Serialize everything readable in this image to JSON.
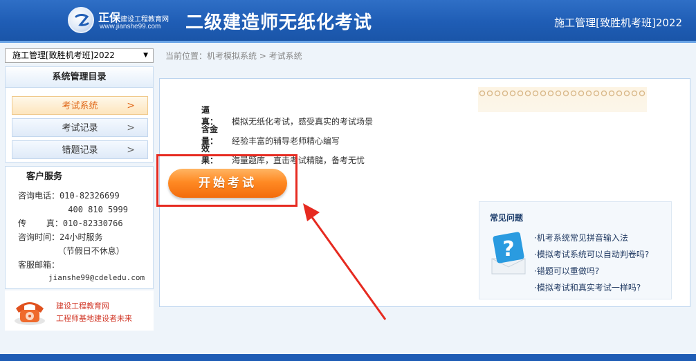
{
  "header": {
    "logo_name": "正保",
    "logo_sub": "建设工程教育网",
    "logo_url": "www.jianshe99.com",
    "app_title": "二级建造师无纸化考试",
    "course_title": "施工管理[致胜机考班]2022"
  },
  "sidebar": {
    "course_select": "施工管理[致胜机考班]2022",
    "menu_title": "系统管理目录",
    "items": [
      {
        "label": "考试系统",
        "active": true
      },
      {
        "label": "考试记录",
        "active": false
      },
      {
        "label": "错题记录",
        "active": false
      }
    ],
    "service": {
      "title": "客户服务",
      "lines": [
        "咨询电话：010-82326699",
        "          400 810 5999",
        "传    真：010-82330766",
        "咨询时间：24小时服务",
        "        （节假日不休息）",
        "客服邮箱："
      ],
      "email": "jianshe99@cdeledu.com"
    },
    "promo": {
      "line1": "建设工程教育网",
      "line2": "工程师基地建设者未来"
    }
  },
  "breadcrumb": "当前位置：机考模拟系统 > 考试系统",
  "main": {
    "features": [
      {
        "key": "逼　真：",
        "text": "模拟无纸化考试，感受真实的考试场景"
      },
      {
        "key": "含金量：",
        "text": "经验丰富的辅导老师精心编写"
      },
      {
        "key": "效　果：",
        "text": "海量题库，直击考试精髓，备考无忧"
      }
    ],
    "start_button": "开始考试"
  },
  "faq": {
    "title": "常见问题",
    "items": [
      "机考系统常见拼音输入法",
      "模拟考试系统可以自动判卷吗?",
      "错题可以重做吗?",
      "模拟考试和真实考试一样吗?"
    ]
  },
  "colors": {
    "header_blue": "#1f5db5",
    "accent_orange": "#f36c0c",
    "highlight_red": "#e62a20"
  }
}
